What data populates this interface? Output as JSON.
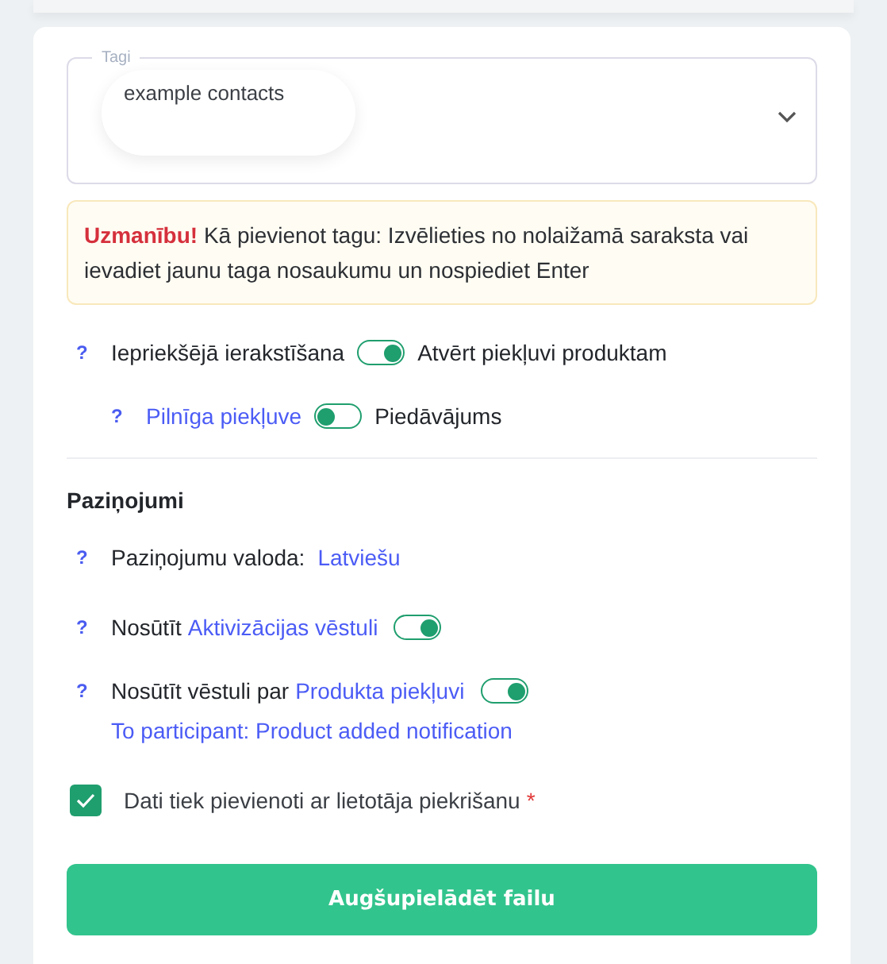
{
  "tags": {
    "legend": "Tagi",
    "chips": [
      "example contacts"
    ]
  },
  "warning": {
    "text": "**Uzmanību!** Kā pievienot tagu: Izvēlieties no nolaižamā saraksta vai ievadiet jaunu taga nosaukumu un nospiediet Enter"
  },
  "access": [
    {
      "help": "?",
      "label": "Iepriekšējā ierakstīšana",
      "kind": "plain",
      "on": true,
      "option": "Atvērt piekļuvi produktam",
      "children": [
        {
          "help": "?",
          "label": "Pilnīga piekļuve",
          "kind": "link",
          "on": false,
          "option": "Piedāvājums"
        }
      ]
    }
  ],
  "notifications": {
    "title": "Paziņojumi",
    "language": {
      "help": "?",
      "label": "Paziņojumu valoda:",
      "value": "Latviešu"
    },
    "emails": [
      {
        "help": "?",
        "prefix": "Nosūtīt",
        "link": "Aktivizācijas vēstuli",
        "on": true
      },
      {
        "help": "?",
        "prefix": "Nosūtīt vēstuli par",
        "link": "Produkta piekļuvi",
        "on": true,
        "detail": "To participant: Product added notification"
      }
    ]
  },
  "consent": {
    "checked": true,
    "label": "Dati tiek pievienoti ar lietotāja piekrišanu",
    "required_mark": "*"
  },
  "button": "Augšupielādēt failu"
}
